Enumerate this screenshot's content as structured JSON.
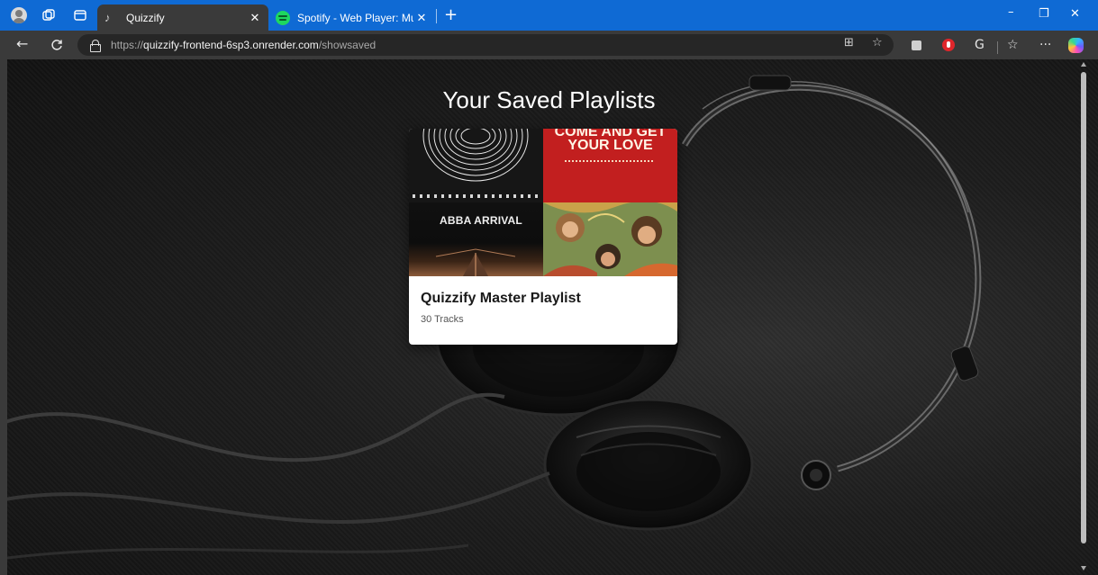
{
  "browser": {
    "tabs": [
      {
        "title": "Quizzify",
        "active": true,
        "favicon": "music-note-icon"
      },
      {
        "title": "Spotify - Web Player: Music for ev",
        "active": false,
        "favicon": "spotify-icon"
      }
    ],
    "tab_close_glyph": "✕",
    "new_tab_glyph": "+",
    "address": {
      "scheme": "https://",
      "host": "quizzify-frontend-6sp3.onrender.com",
      "path": "/showsaved"
    },
    "window_controls": {
      "minimize": "–",
      "maximize": "❐",
      "close": "✕"
    },
    "toolbar_glyphs": {
      "back": "←",
      "reload": "C",
      "reading_view": "⊞",
      "favorite": "☆",
      "extensions": "G",
      "favorites": "☆",
      "more": "···"
    },
    "accent_color": "#0f6ad4"
  },
  "page": {
    "heading": "Your Saved Playlists",
    "playlists": [
      {
        "title": "Quizzify Master Playlist",
        "track_count_label": "30 Tracks",
        "cover_texts": {
          "top_right": "COME AND GET\nYOUR LOVE",
          "bottom_left": "ABBA ARRIVAL"
        }
      }
    ]
  }
}
